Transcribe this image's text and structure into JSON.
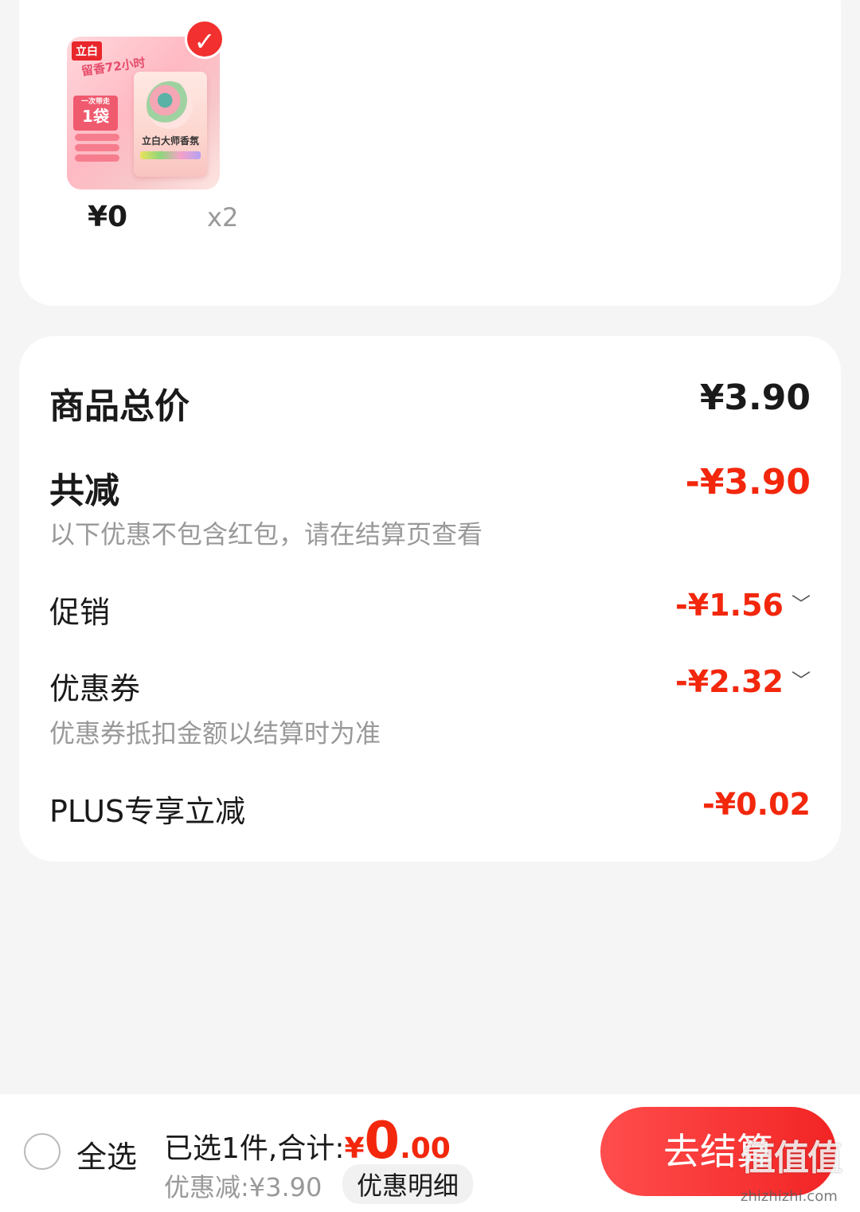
{
  "product": {
    "image_alt": "立白 大师香氛 洗衣粉",
    "image_text": {
      "brand": "立白",
      "tag_scent": "留香72小时",
      "tag_count_small": "一次带走",
      "tag_count": "1袋",
      "bag_label": "立白大师香氛"
    },
    "selected": true,
    "price": "¥0",
    "quantity": "x2"
  },
  "summary": {
    "total_label": "商品总价",
    "total_value": "¥3.90",
    "reduce_label": "共减",
    "reduce_value": "-¥3.90",
    "reduce_note": "以下优惠不包含红包，请在结算页查看",
    "promo_label": "促销",
    "promo_value": "-¥1.56",
    "coupon_label": "优惠券",
    "coupon_value": "-¥2.32",
    "coupon_note": "优惠券抵扣金额以结算时为准",
    "plus_label": "PLUS专享立减",
    "plus_value": "-¥0.02"
  },
  "bottom": {
    "select_all": "全选",
    "selected_text": "已选1件,合计:",
    "total_currency": "¥",
    "total_int": "0",
    "total_dec": ".00",
    "discount_text": "优惠减:¥3.90",
    "detail_button": "优惠明细",
    "checkout_button": "去结算",
    "watermark": "值值值",
    "watermark_url": "zhizhizhi.com"
  },
  "colors": {
    "accent_red": "#f2270c",
    "checkout_red": "#f22424",
    "page_bg": "#f5f5f5"
  }
}
